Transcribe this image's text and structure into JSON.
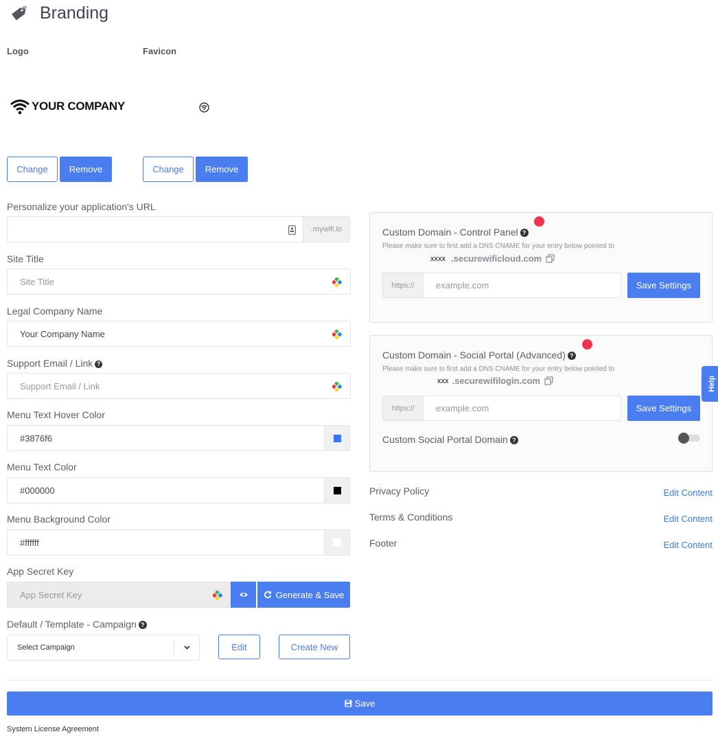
{
  "page": {
    "title": "Branding",
    "title_icon": "tag-icon"
  },
  "logos": {
    "logo_label": "Logo",
    "favicon_label": "Favicon",
    "logo_text": "YOUR COMPANY",
    "change_label": "Change",
    "remove_label": "Remove"
  },
  "form": {
    "url": {
      "label": "Personalize your application's URL",
      "value": "",
      "suffix": ".mywifi.io"
    },
    "site_title": {
      "label": "Site Title",
      "placeholder": "Site Title"
    },
    "legal_name": {
      "label": "Legal Company Name",
      "value": "Your Company Name"
    },
    "support": {
      "label": "Support Email / Link",
      "placeholder": "Support Email / Link"
    },
    "hover_color": {
      "label": "Menu Text Hover Color",
      "value": "#3876f6",
      "swatch": "#3876f6"
    },
    "text_color": {
      "label": "Menu Text Color",
      "value": "#000000",
      "swatch": "#000000"
    },
    "bg_color": {
      "label": "Menu Background Color",
      "value": "#ffffff",
      "swatch": "#ffffff"
    },
    "secret_key": {
      "label": "App Secret Key",
      "placeholder": "App Secret Key",
      "generate_label": "Generate & Save"
    },
    "campaign": {
      "label": "Default / Template - Campaign",
      "selected": "Select Campaign",
      "edit_label": "Edit",
      "create_label": "Create New"
    }
  },
  "control_panel": {
    "title": "Custom Domain - Control Panel",
    "note": "Please make sure to first add a DNS CNAME for your entry below pointed to",
    "cname_prefix": "xxxx",
    "cname_domain": ".securewificloud.com",
    "protocol": "https://",
    "placeholder": "example.com",
    "save_label": "Save Settings"
  },
  "social_portal": {
    "title": "Custom Domain - Social Portal (Advanced)",
    "note": "Please make sure to first add a DNS CNAME for your entry below pointed to",
    "cname_prefix": "xxx",
    "cname_domain": ".securewifilogin.com",
    "protocol": "https://",
    "placeholder": "example.com",
    "save_label": "Save Settings",
    "toggle_label": "Custom Social Portal Domain",
    "toggle_on": false
  },
  "content_links": [
    {
      "label": "Privacy Policy",
      "action": "Edit Content"
    },
    {
      "label": "Terms & Conditions",
      "action": "Edit Content"
    },
    {
      "label": "Footer",
      "action": "Edit Content"
    }
  ],
  "help_tab": "Help",
  "save_label": "Save",
  "footer_link": "System License Agreement",
  "colors": {
    "accent": "#4a7ef0",
    "link": "#3b7ad9",
    "notification_dot": "#f0344f"
  }
}
